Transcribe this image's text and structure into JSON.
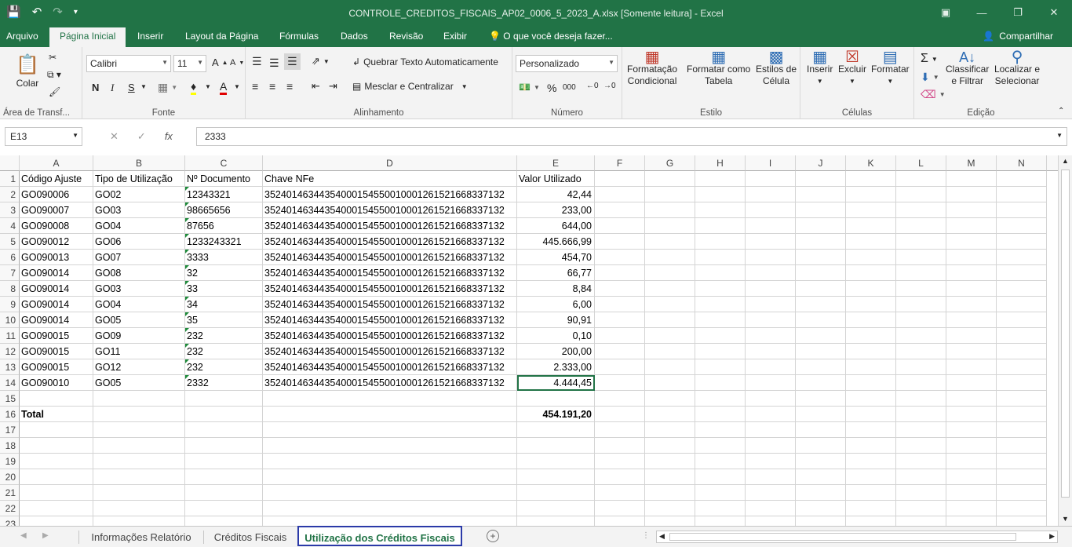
{
  "window": {
    "title": "CONTROLE_CREDITOS_FISCAIS_AP02_0006_5_2023_A.xlsx  [Somente leitura] - Excel"
  },
  "menu": {
    "tabs": [
      "Arquivo",
      "Página Inicial",
      "Inserir",
      "Layout da Página",
      "Fórmulas",
      "Dados",
      "Revisão",
      "Exibir"
    ],
    "search": "O que você deseja fazer...",
    "share": "Compartilhar"
  },
  "ribbon": {
    "clipboard": {
      "paste": "Colar",
      "label": "Área de Transf..."
    },
    "font": {
      "name": "Calibri",
      "size": "11",
      "bold": "N",
      "italic": "I",
      "underline": "S",
      "label": "Fonte"
    },
    "alignment": {
      "wrap": "Quebrar Texto Automaticamente",
      "merge": "Mesclar e Centralizar",
      "label": "Alinhamento"
    },
    "number": {
      "format": "Personalizado",
      "label": "Número"
    },
    "styles": {
      "conditional": [
        "Formatação",
        "Condicional"
      ],
      "as_table": [
        "Formatar como",
        "Tabela"
      ],
      "cell_styles": [
        "Estilos de",
        "Célula"
      ],
      "label": "Estilo"
    },
    "cells": {
      "insert": "Inserir",
      "delete": "Excluir",
      "format": "Formatar",
      "label": "Células"
    },
    "editing": {
      "sort": [
        "Classificar",
        "e Filtrar"
      ],
      "find": [
        "Localizar e",
        "Selecionar"
      ],
      "label": "Edição"
    }
  },
  "formula_bar": {
    "name_box": "E13",
    "value": "2333"
  },
  "columns": [
    "A",
    "B",
    "C",
    "D",
    "E",
    "F",
    "G",
    "H",
    "I",
    "J",
    "K",
    "L",
    "M",
    "N"
  ],
  "rows": [
    [
      "Código Ajuste",
      "Tipo de Utilização",
      "Nº Documento",
      "Chave NFe",
      "Valor Utilizado"
    ],
    [
      "GO090006",
      "GO02",
      "12343321",
      "35240146344354000154550010001261521668337132",
      "42,44"
    ],
    [
      "GO090007",
      "GO03",
      "98665656",
      "35240146344354000154550010001261521668337132",
      "233,00"
    ],
    [
      "GO090008",
      "GO04",
      "87656",
      "35240146344354000154550010001261521668337132",
      "644,00"
    ],
    [
      "GO090012",
      "GO06",
      "1233243321",
      "35240146344354000154550010001261521668337132",
      "445.666,99"
    ],
    [
      "GO090013",
      "GO07",
      "3333",
      "35240146344354000154550010001261521668337132",
      "454,70"
    ],
    [
      "GO090014",
      "GO08",
      "32",
      "35240146344354000154550010001261521668337132",
      "66,77"
    ],
    [
      "GO090014",
      "GO03",
      "33",
      "35240146344354000154550010001261521668337132",
      "8,84"
    ],
    [
      "GO090014",
      "GO04",
      "34",
      "35240146344354000154550010001261521668337132",
      "6,00"
    ],
    [
      "GO090014",
      "GO05",
      "35",
      "35240146344354000154550010001261521668337132",
      "90,91"
    ],
    [
      "GO090015",
      "GO09",
      "232",
      "35240146344354000154550010001261521668337132",
      "0,10"
    ],
    [
      "GO090015",
      "GO11",
      "232",
      "35240146344354000154550010001261521668337132",
      "200,00"
    ],
    [
      "GO090015",
      "GO12",
      "232",
      "35240146344354000154550010001261521668337132",
      "2.333,00"
    ],
    [
      "GO090010",
      "GO05",
      "2332",
      "35240146344354000154550010001261521668337132",
      "4.444,45"
    ],
    [
      "",
      "",
      "",
      "",
      ""
    ],
    [
      "Total",
      "",
      "",
      "",
      "454.191,20"
    ]
  ],
  "row_numbers": [
    "1",
    "2",
    "3",
    "4",
    "5",
    "6",
    "7",
    "8",
    "9",
    "10",
    "11",
    "12",
    "13",
    "14",
    "15",
    "16",
    "17",
    "18",
    "19",
    "20",
    "21",
    "22",
    "23"
  ],
  "sheets": [
    "Informações Relatório",
    "Créditos Fiscais",
    "Utilização dos Créditos Fiscais"
  ],
  "active_sheet": "Utilização dos Créditos Fiscais",
  "colors": {
    "accent": "#217346",
    "grid": "#d4d4d4",
    "active_tab_border": "#2b3aa8"
  }
}
